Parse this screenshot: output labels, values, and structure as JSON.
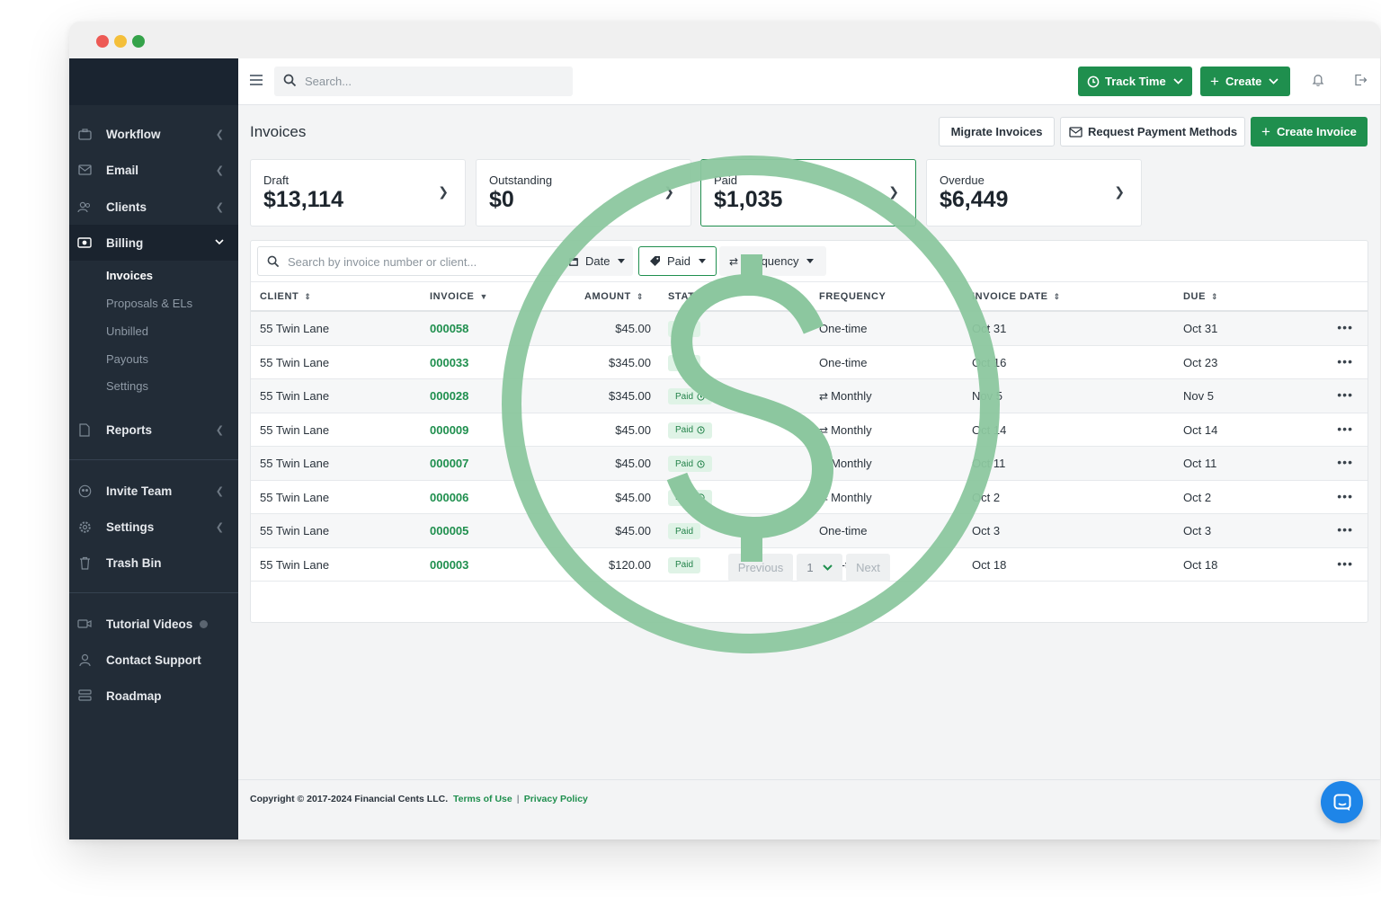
{
  "topbar": {
    "search_placeholder": "Search...",
    "track_time_label": "Track Time",
    "create_label": "Create"
  },
  "sidebar": {
    "items": [
      {
        "label": "Workflow",
        "icon": "briefcase-icon"
      },
      {
        "label": "Email",
        "icon": "envelope-icon"
      },
      {
        "label": "Clients",
        "icon": "users-icon"
      },
      {
        "label": "Billing",
        "icon": "money-icon"
      },
      {
        "label": "Reports",
        "icon": "file-icon"
      },
      {
        "label": "Invite Team",
        "icon": "team-icon"
      },
      {
        "label": "Settings",
        "icon": "gear-icon"
      },
      {
        "label": "Trash Bin",
        "icon": "trash-icon"
      },
      {
        "label": "Tutorial Videos",
        "icon": "video-icon"
      },
      {
        "label": "Contact Support",
        "icon": "person-icon"
      },
      {
        "label": "Roadmap",
        "icon": "roadmap-icon"
      }
    ],
    "billing_sub": [
      "Invoices",
      "Proposals & ELs",
      "Unbilled",
      "Payouts",
      "Settings"
    ]
  },
  "page": {
    "title": "Invoices",
    "migrate_label": "Migrate Invoices",
    "request_label": "Request Payment Methods",
    "create_invoice_label": "Create Invoice"
  },
  "cards": [
    {
      "label": "Draft",
      "value": "$13,114"
    },
    {
      "label": "Outstanding",
      "value": "$0"
    },
    {
      "label": "Paid",
      "value": "$1,035"
    },
    {
      "label": "Overdue",
      "value": "$6,449"
    }
  ],
  "filters": {
    "search_placeholder": "Search by invoice number or client...",
    "date_label": "Date",
    "status_label": "Paid",
    "frequency_label": "Frequency"
  },
  "table": {
    "headers": [
      "CLIENT",
      "INVOICE",
      "AMOUNT",
      "STATUS",
      "FREQUENCY",
      "INVOICE DATE",
      "DUE"
    ],
    "rows": [
      {
        "client": "55 Twin Lane",
        "invoice": "000058",
        "amount": "$45.00",
        "status": "Paid",
        "frequency": "One-time",
        "date": "Oct 31",
        "due": "Oct 31"
      },
      {
        "client": "55 Twin Lane",
        "invoice": "000033",
        "amount": "$345.00",
        "status": "Paid",
        "frequency": "One-time",
        "date": "Oct 16",
        "due": "Oct 23"
      },
      {
        "client": "55 Twin Lane",
        "invoice": "000028",
        "amount": "$345.00",
        "status": "Paid",
        "frequency": "Monthly",
        "date": "Nov 5",
        "due": "Nov 5"
      },
      {
        "client": "55 Twin Lane",
        "invoice": "000009",
        "amount": "$45.00",
        "status": "Paid",
        "frequency": "Monthly",
        "date": "Oct 14",
        "due": "Oct 14"
      },
      {
        "client": "55 Twin Lane",
        "invoice": "000007",
        "amount": "$45.00",
        "status": "Paid",
        "frequency": "Monthly",
        "date": "Oct 11",
        "due": "Oct 11"
      },
      {
        "client": "55 Twin Lane",
        "invoice": "000006",
        "amount": "$45.00",
        "status": "Paid",
        "frequency": "Monthly",
        "date": "Oct 2",
        "due": "Oct 2"
      },
      {
        "client": "55 Twin Lane",
        "invoice": "000005",
        "amount": "$45.00",
        "status": "Paid",
        "frequency": "One-time",
        "date": "Oct 3",
        "due": "Oct 3"
      },
      {
        "client": "55 Twin Lane",
        "invoice": "000003",
        "amount": "$120.00",
        "status": "Paid",
        "frequency": "One-time",
        "date": "Oct 18",
        "due": "Oct 18"
      }
    ]
  },
  "pagination": {
    "previous": "Previous",
    "page": "1",
    "next": "Next"
  },
  "footer": {
    "copyright": "Copyright © 2017-2024 Financial Cents LLC.",
    "terms": "Terms of Use",
    "separator": "|",
    "privacy": "Privacy Policy"
  },
  "colors": {
    "accent": "#1f8f4e",
    "sidebar": "#222c37",
    "chat": "#1e85e8",
    "watermark": "#8cc79f"
  }
}
